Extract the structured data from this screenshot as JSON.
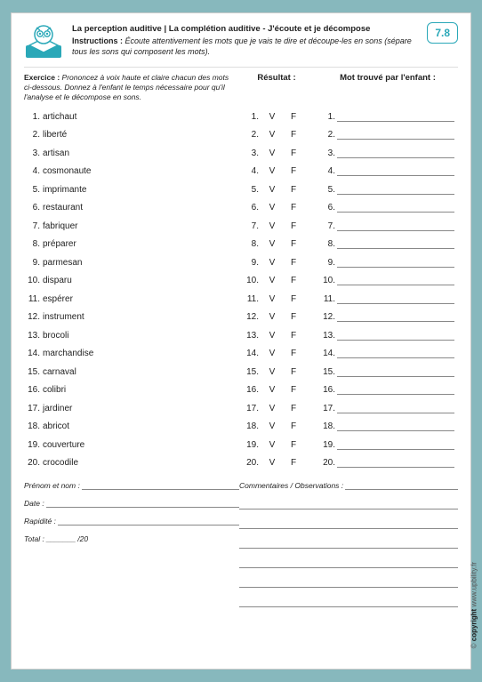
{
  "header": {
    "title": "La perception auditive | La complétion auditive - J'écoute et je décompose",
    "instructions_label": "Instructions :",
    "instructions_body": "Écoute attentivement les mots que je vais te dire et découpe-les en sons (sépare tous les sons qui composent les mots).",
    "badge": "7.8"
  },
  "exercice": {
    "label": "Exercice :",
    "body": "Prononcez à voix haute et claire chacun des mots ci-dessous. Donnez à l'enfant le temps nécessaire pour qu'il l'analyse et le décompose en sons.",
    "result_header": "Résultat :",
    "found_header": "Mot trouvé par l'enfant :"
  },
  "vf": {
    "v": "V",
    "f": "F"
  },
  "words": [
    {
      "n": "1.",
      "w": "artichaut"
    },
    {
      "n": "2.",
      "w": "liberté"
    },
    {
      "n": "3.",
      "w": "artisan"
    },
    {
      "n": "4.",
      "w": "cosmonaute"
    },
    {
      "n": "5.",
      "w": "imprimante"
    },
    {
      "n": "6.",
      "w": "restaurant"
    },
    {
      "n": "7.",
      "w": "fabriquer"
    },
    {
      "n": "8.",
      "w": "préparer"
    },
    {
      "n": "9.",
      "w": "parmesan"
    },
    {
      "n": "10.",
      "w": "disparu"
    },
    {
      "n": "11.",
      "w": "espérer"
    },
    {
      "n": "12.",
      "w": "instrument"
    },
    {
      "n": "13.",
      "w": "brocoli"
    },
    {
      "n": "14.",
      "w": "marchandise"
    },
    {
      "n": "15.",
      "w": "carnaval"
    },
    {
      "n": "16.",
      "w": "colibri"
    },
    {
      "n": "17.",
      "w": "jardiner"
    },
    {
      "n": "18.",
      "w": "abricot"
    },
    {
      "n": "19.",
      "w": "couverture"
    },
    {
      "n": "20.",
      "w": "crocodile"
    }
  ],
  "footer": {
    "prenom": "Prénom et nom :",
    "date": "Date :",
    "rapidite": "Rapidité :",
    "total_prefix": "Total :    _______",
    "total_suffix": "/20",
    "comments": "Commentaires / Observations :"
  },
  "copyright": {
    "sym": "© ",
    "bold": "copyright",
    "rest": " www.upbility.fr"
  }
}
